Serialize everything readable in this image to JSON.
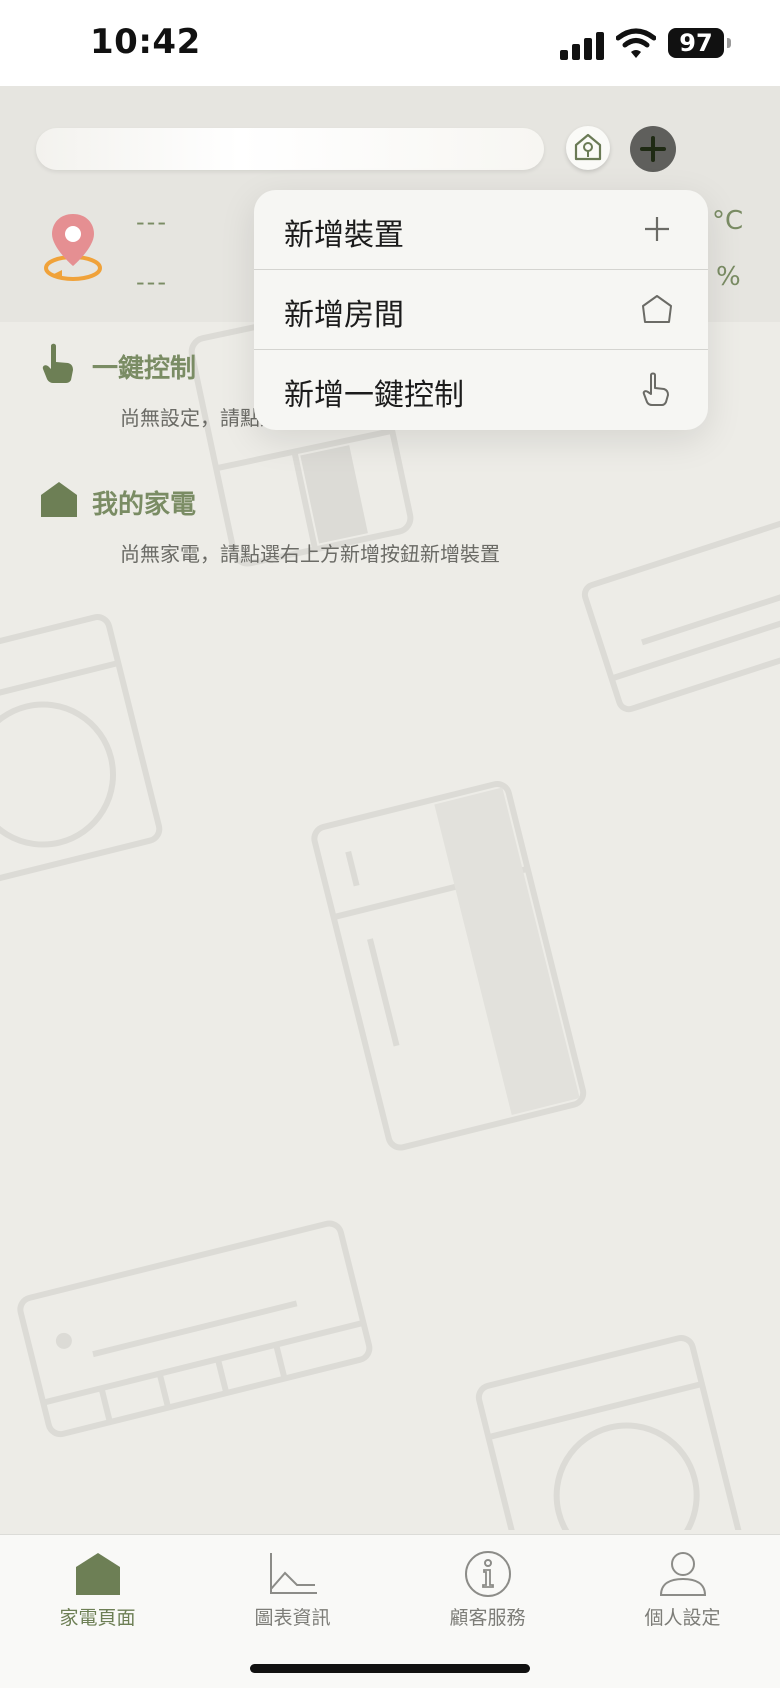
{
  "status_bar": {
    "time": "10:42",
    "battery": "97"
  },
  "header": {
    "search_placeholder": "",
    "location_line1": "---",
    "location_line2": "---",
    "temperature_unit": "°C",
    "humidity_unit": "%"
  },
  "dropdown_menu": {
    "items": [
      {
        "label": "新增裝置",
        "icon": "plus-icon"
      },
      {
        "label": "新增房間",
        "icon": "house-outline-icon"
      },
      {
        "label": "新增一鍵控制",
        "icon": "hand-pointer-icon"
      }
    ]
  },
  "sections": {
    "one_key": {
      "title": "一鍵控制",
      "empty_text": "尚無設定，請點選右上方新增按鈕新增一鍵控制"
    },
    "my_appliances": {
      "title": "我的家電",
      "empty_text": "尚無家電，請點選右上方新增按鈕新增裝置"
    }
  },
  "tab_bar": {
    "tabs": [
      {
        "label": "家電頁面",
        "icon": "home-icon",
        "active": true
      },
      {
        "label": "圖表資訊",
        "icon": "chart-icon",
        "active": false
      },
      {
        "label": "顧客服務",
        "icon": "info-icon",
        "active": false
      },
      {
        "label": "個人設定",
        "icon": "person-icon",
        "active": false
      }
    ]
  },
  "colors": {
    "accent_green": "#7a8c64",
    "location_pin": "#e58f92",
    "location_orbit": "#f0a23a",
    "plus_button": "#5f5f5c"
  }
}
